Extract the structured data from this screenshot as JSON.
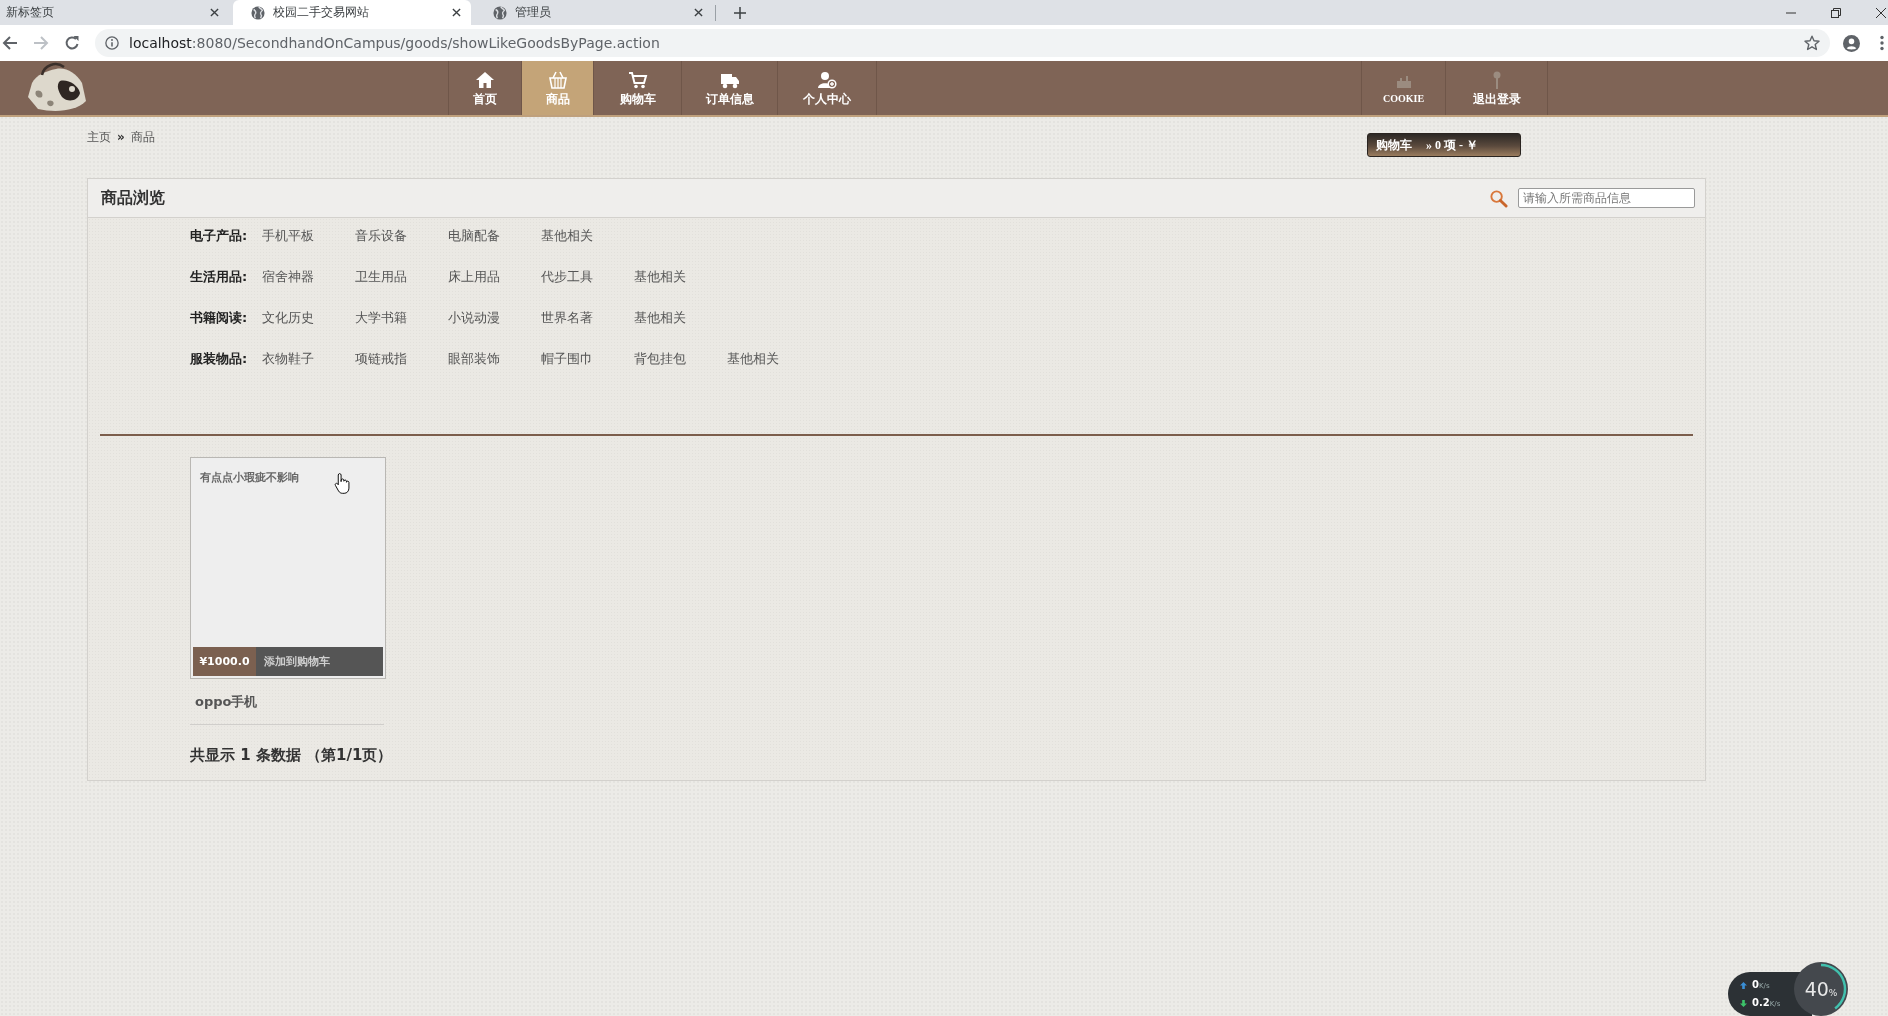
{
  "browser": {
    "tabs": [
      {
        "title": "新标签页",
        "kind": "new_tab",
        "selected": false
      },
      {
        "title": "校园二手交易网站",
        "kind": "page",
        "selected": true
      },
      {
        "title": "管理员",
        "kind": "page",
        "selected": false
      }
    ],
    "url": {
      "host": "localhost",
      "path": ":8080/SecondhandOnCampus/goods/showLikeGoodsByPage.action"
    }
  },
  "site": {
    "nav": [
      {
        "label": "首页",
        "kind": "home",
        "selected": false
      },
      {
        "label": "商品",
        "kind": "goods",
        "selected": true
      },
      {
        "label": "购物车",
        "kind": "cart",
        "selected": false
      },
      {
        "label": "订单信息",
        "kind": "orders",
        "selected": false
      },
      {
        "label": "个人中心",
        "kind": "user",
        "selected": false
      }
    ],
    "account_nav": [
      {
        "label": "COOKIE",
        "kind": "cookie",
        "selected": false
      },
      {
        "label": "退出登录",
        "kind": "logout",
        "selected": false
      }
    ],
    "breadcrumb": {
      "items": [
        "主页",
        "商品"
      ],
      "separator": "»"
    },
    "cart_summary": {
      "label": "购物车",
      "summary": "» 0 项 - ￥"
    },
    "panel": {
      "title": "商品浏览",
      "search": {
        "placeholder": "请输入所需商品信息"
      },
      "categories": [
        {
          "name": "电子产品:",
          "items": [
            "手机平板",
            "音乐设备",
            "电脑配备",
            "基他相关"
          ]
        },
        {
          "name": "生活用品:",
          "items": [
            "宿舍神器",
            "卫生用品",
            "床上用品",
            "代步工具",
            "基他相关"
          ]
        },
        {
          "name": "书籍阅读:",
          "items": [
            "文化历史",
            "大学书籍",
            "小说动漫",
            "世界名著",
            "基他相关"
          ]
        },
        {
          "name": "服装物品:",
          "items": [
            "衣物鞋子",
            "项链戒指",
            "眼部装饰",
            "帽子围巾",
            "背包挂包",
            "基他相关"
          ]
        }
      ],
      "products": [
        {
          "description": "有点点小瑕疵不影响",
          "price": "¥1000.0",
          "action": "添加到购物车",
          "name": "oppo手机"
        }
      ],
      "summary": "共显示 1 条数据 （第1/1页）"
    }
  },
  "net_monitor": {
    "upload": {
      "value": "0",
      "unit": "K/s"
    },
    "download": {
      "value": "0.2",
      "unit": "K/s"
    },
    "memory": {
      "value": "40",
      "unit": "%",
      "level": 0.4
    }
  }
}
